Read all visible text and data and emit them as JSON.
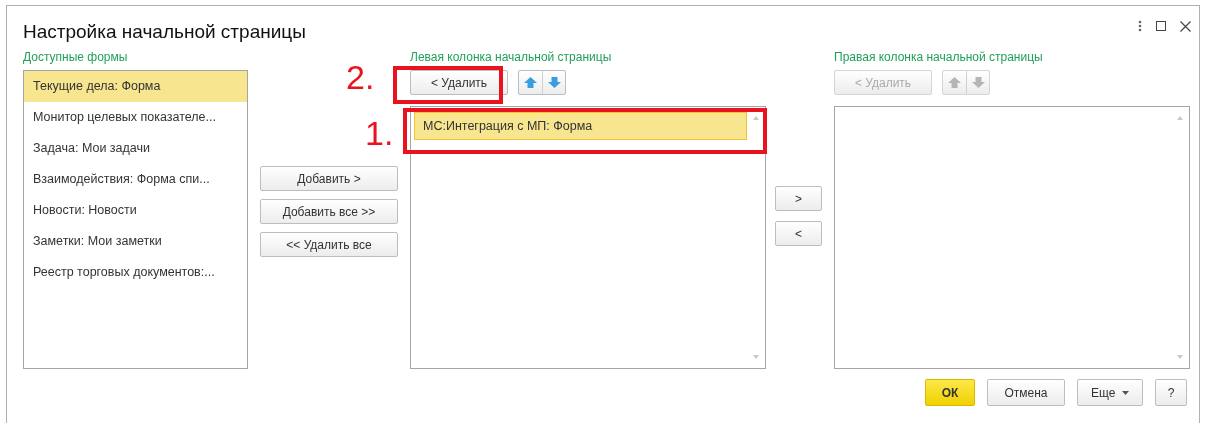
{
  "window": {
    "title": "Настройка начальной страницы"
  },
  "available": {
    "label": "Доступные формы",
    "items": [
      {
        "text": "Текущие дела: Форма",
        "selected": true
      },
      {
        "text": "Монитор целевых показателе...",
        "selected": false
      },
      {
        "text": "Задача: Мои задачи",
        "selected": false
      },
      {
        "text": "Взаимодействия: Форма спи...",
        "selected": false
      },
      {
        "text": "Новости: Новости",
        "selected": false
      },
      {
        "text": "Заметки: Мои заметки",
        "selected": false
      },
      {
        "text": "Реестр торговых документов:...",
        "selected": false
      }
    ]
  },
  "transfer_buttons": [
    "Добавить >",
    "Добавить все >>",
    "<< Удалить все"
  ],
  "left_column": {
    "label": "Левая колонка начальной страницы",
    "remove_button": {
      "label": "< Удалить",
      "disabled": false
    },
    "move_disabled": false,
    "items": [
      {
        "text": "МС:Интеграция с МП: Форма",
        "selected": true
      }
    ]
  },
  "column_buttons": [
    ">",
    "<"
  ],
  "right_column": {
    "label": "Правая колонка начальной страницы",
    "remove_button": {
      "label": "< Удалить",
      "disabled": true
    },
    "move_disabled": true
  },
  "footer_buttons": [
    {
      "label": "ОК",
      "kind": "default"
    },
    {
      "label": "Отмена",
      "kind": "plain"
    },
    {
      "label": "Еще",
      "kind": "menu"
    },
    {
      "label": "?",
      "kind": "plain"
    }
  ],
  "annotations": [
    {
      "number": "1."
    },
    {
      "number": "2."
    }
  ]
}
